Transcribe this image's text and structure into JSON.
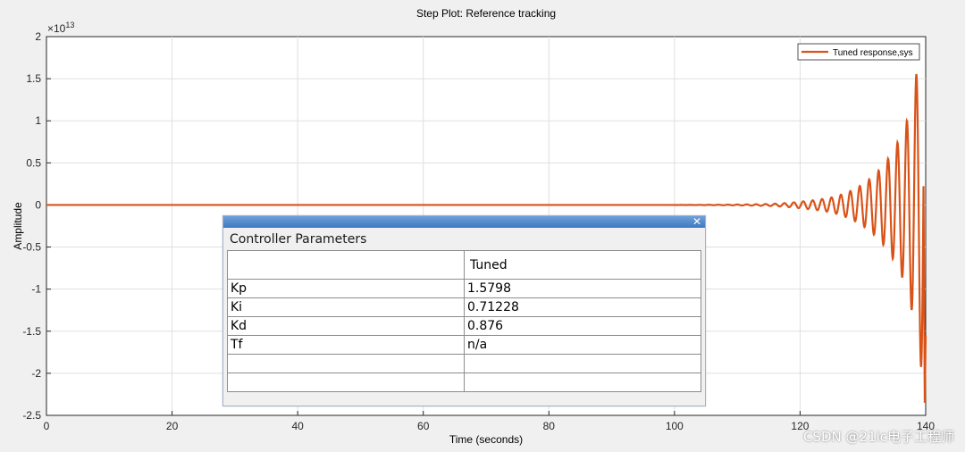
{
  "chart_data": {
    "type": "line",
    "title": "Step Plot: Reference tracking",
    "xlabel": "Time (seconds)",
    "ylabel": "Amplitude",
    "exponent_base": "×10",
    "exponent_power": "13",
    "xlim": [
      0,
      140
    ],
    "ylim": [
      -2.5,
      2.0
    ],
    "xticks": [
      0,
      20,
      40,
      60,
      80,
      100,
      120,
      140
    ],
    "yticks": [
      2,
      1.5,
      1,
      0.5,
      0,
      -0.5,
      -1,
      -1.5,
      -2,
      -2.5
    ],
    "ytick_labels": [
      "2",
      "1.5",
      "1",
      "0.5",
      "0",
      "-0.5",
      "-1",
      "-1.5",
      "-2",
      "-2.5"
    ],
    "grid": true,
    "legend_position": "top-right",
    "series": [
      {
        "name": "Tuned response,sys",
        "color": "#d95319",
        "shape": "exponentially growing oscillation",
        "envelope_points": [
          [
            105,
            0.002
          ],
          [
            115,
            0.012
          ],
          [
            120,
            0.04
          ],
          [
            125,
            0.09
          ],
          [
            130,
            0.25
          ],
          [
            134,
            0.55
          ],
          [
            137,
            1.0
          ],
          [
            139,
            1.8
          ],
          [
            140,
            2.35
          ]
        ],
        "period": 1.5,
        "end_value": -1.55
      }
    ]
  },
  "dialog": {
    "close_icon": "close-icon",
    "close_glyph": "✕",
    "header": "Controller Parameters",
    "columns": [
      "",
      "Tuned"
    ],
    "rows": [
      [
        "Kp",
        "1.5798"
      ],
      [
        "Ki",
        "0.71228"
      ],
      [
        "Kd",
        "0.876"
      ],
      [
        "Tf",
        "n/a"
      ],
      [
        "",
        ""
      ],
      [
        "",
        ""
      ]
    ]
  },
  "watermark": "CSDN @21ic电子工程师",
  "colors": {
    "response": "#d95319",
    "grid": "#dfdfdf",
    "axes_bg": "#ffffff",
    "figure_bg": "#f0f0f0",
    "titlebar": "#4f86cc"
  }
}
